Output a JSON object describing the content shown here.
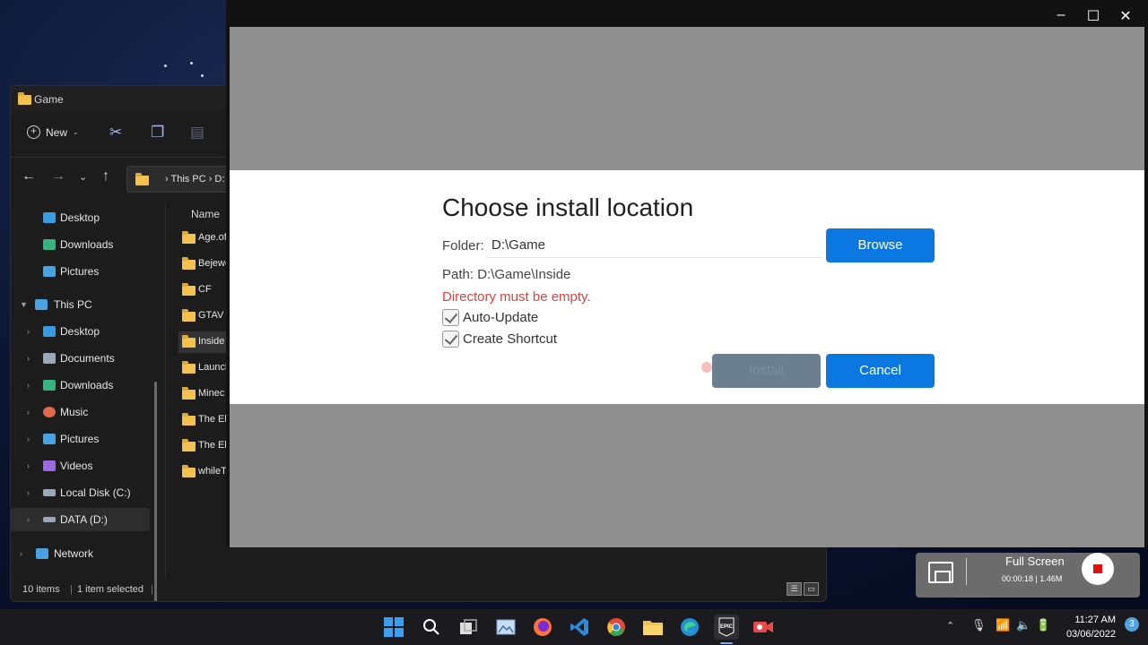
{
  "explorer": {
    "title": "Game",
    "toolbar": {
      "new_label": "New"
    },
    "address": {
      "segments": "› This PC › D:"
    },
    "nav": [
      {
        "label": "Desktop",
        "icon": "desktop-icon",
        "color": "#3a9be0"
      },
      {
        "label": "Downloads",
        "icon": "download-icon",
        "color": "#36b37e"
      },
      {
        "label": "Pictures",
        "icon": "pictures-icon",
        "color": "#4aa3e0"
      },
      {
        "label": "This PC",
        "icon": "pc-icon",
        "color": "#4aa3e0"
      },
      {
        "label": "Desktop",
        "icon": "desktop-icon",
        "color": "#3a9be0"
      },
      {
        "label": "Documents",
        "icon": "documents-icon",
        "color": "#9aa7b8"
      },
      {
        "label": "Downloads",
        "icon": "download-icon",
        "color": "#36b37e"
      },
      {
        "label": "Music",
        "icon": "music-icon",
        "color": "#e06a4a"
      },
      {
        "label": "Pictures",
        "icon": "pictures-icon",
        "color": "#4aa3e0"
      },
      {
        "label": "Videos",
        "icon": "videos-icon",
        "color": "#9b6ae0"
      },
      {
        "label": "Local Disk (C:)",
        "icon": "disk-icon",
        "color": "#9aa7b8"
      },
      {
        "label": "DATA (D:)",
        "icon": "disk-icon",
        "color": "#9aa7b8"
      },
      {
        "label": "Network",
        "icon": "network-icon",
        "color": "#4aa3e0"
      }
    ],
    "file_column_header": "Name",
    "files": [
      "Age.of",
      "Bejewe",
      "CF",
      "GTAV",
      "Inside",
      "Launcl",
      "Minec",
      "The Elc",
      "The Elc",
      "whileT"
    ],
    "status": {
      "item_count": "10 items",
      "selected": "1 item selected"
    }
  },
  "epic_dialog": {
    "title": "Choose install location",
    "folder_label": "Folder:",
    "folder_value": "D:\\Game",
    "browse_label": "Browse",
    "path_text": "Path: D:\\Game\\Inside",
    "error_text": "Directory must be empty.",
    "auto_update_label": "Auto-Update",
    "create_shortcut_label": "Create Shortcut",
    "install_label": "Install",
    "cancel_label": "Cancel"
  },
  "recorder": {
    "title": "Full Screen",
    "stats": "00:00:18  |  1.46M"
  },
  "taskbar": {
    "time": "11:27 AM",
    "date": "03/06/2022",
    "notification_count": "3"
  },
  "colors": {
    "accent_blue": "#0a78e0",
    "error_red": "#e0413e",
    "overlay_gray": "#8f8f8f"
  }
}
